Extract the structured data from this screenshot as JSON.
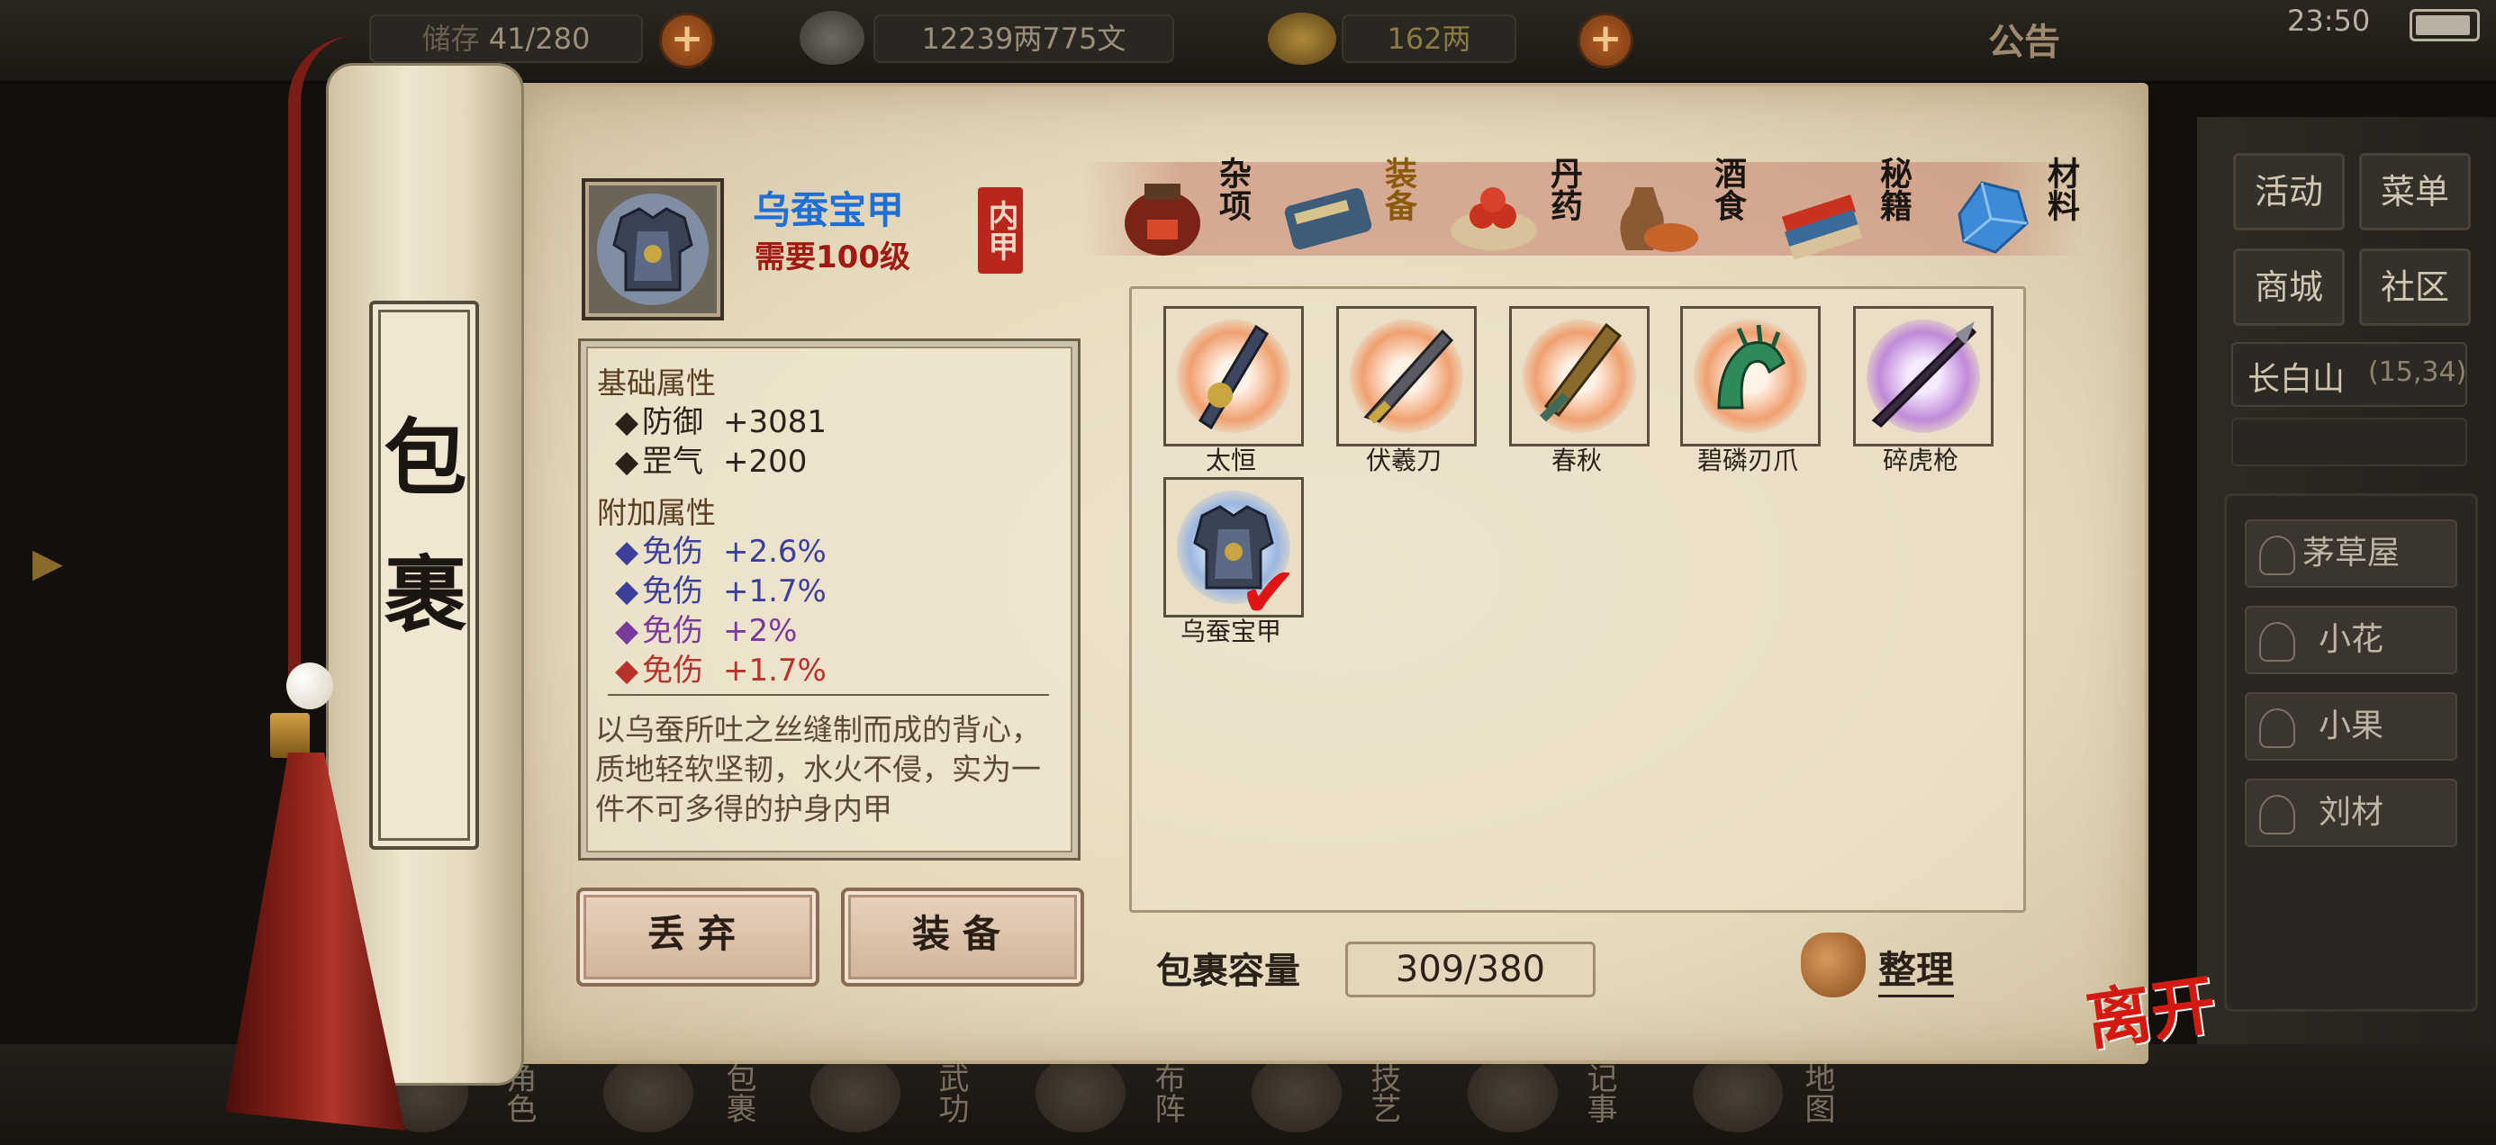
{
  "topbar": {
    "storage_label": "储存",
    "storage_value": "41/280",
    "silver": "12239两775文",
    "gold": "162两",
    "notice": "公告",
    "time": "23:50"
  },
  "right_panel": {
    "buttons": [
      "活动",
      "菜单",
      "商城",
      "社区"
    ],
    "location_name": "长白山",
    "location_coords": "(15,34)",
    "npcs": [
      "茅草屋",
      "小花",
      "小果",
      "刘材"
    ]
  },
  "bottom_nav": [
    "角色",
    "包裹",
    "武功",
    "布阵",
    "技艺",
    "记事",
    "地图"
  ],
  "scroll_title": "包裹",
  "item": {
    "name": "乌蚕宝甲",
    "requirement": "需要100级",
    "slot_tag": "内甲",
    "base_title": "基础属性",
    "base_attrs": [
      {
        "name": "防御",
        "value": "+3081"
      },
      {
        "name": "罡气",
        "value": "+200"
      }
    ],
    "extra_title": "附加属性",
    "extra_attrs": [
      {
        "name": "免伤",
        "value": "+2.6%",
        "color": "#3b3f9a"
      },
      {
        "name": "免伤",
        "value": "+1.7%",
        "color": "#3b3f9a"
      },
      {
        "name": "免伤",
        "value": "+2%",
        "color": "#7a3a9c"
      },
      {
        "name": "免伤",
        "value": "+1.7%",
        "color": "#b8322c"
      }
    ],
    "description": "以乌蚕所吐之丝缝制而成的背心，质地轻软坚韧，水火不侵，实为一件不可多得的护身内甲"
  },
  "actions": {
    "discard": "丢弃",
    "equip": "装备"
  },
  "tabs": [
    {
      "label": "杂项",
      "icon": "jar-icon",
      "active": false
    },
    {
      "label": "装备",
      "icon": "equipment-icon",
      "active": true
    },
    {
      "label": "丹药",
      "icon": "pill-icon",
      "active": false
    },
    {
      "label": "酒食",
      "icon": "wine-food-icon",
      "active": false
    },
    {
      "label": "秘籍",
      "icon": "book-icon",
      "active": false
    },
    {
      "label": "材料",
      "icon": "crystal-icon",
      "active": false
    }
  ],
  "items": [
    {
      "name": "太恒",
      "icon": "staff-weapon-icon",
      "glow": "#f0a070"
    },
    {
      "name": "伏羲刀",
      "icon": "blade-icon",
      "glow": "#f0a070"
    },
    {
      "name": "春秋",
      "icon": "sword-icon",
      "glow": "#f0a070"
    },
    {
      "name": "碧磷刃爪",
      "icon": "claw-icon",
      "glow": "#f0a070"
    },
    {
      "name": "碎虎枪",
      "icon": "spear-icon",
      "glow": "#c08ad8"
    },
    {
      "name": "乌蚕宝甲",
      "icon": "armor-icon",
      "glow": "#9bb6e0",
      "equipped": true
    }
  ],
  "capacity": {
    "label": "包裹容量",
    "value": "309/380"
  },
  "tidy_label": "整理",
  "leave_label": "离开"
}
